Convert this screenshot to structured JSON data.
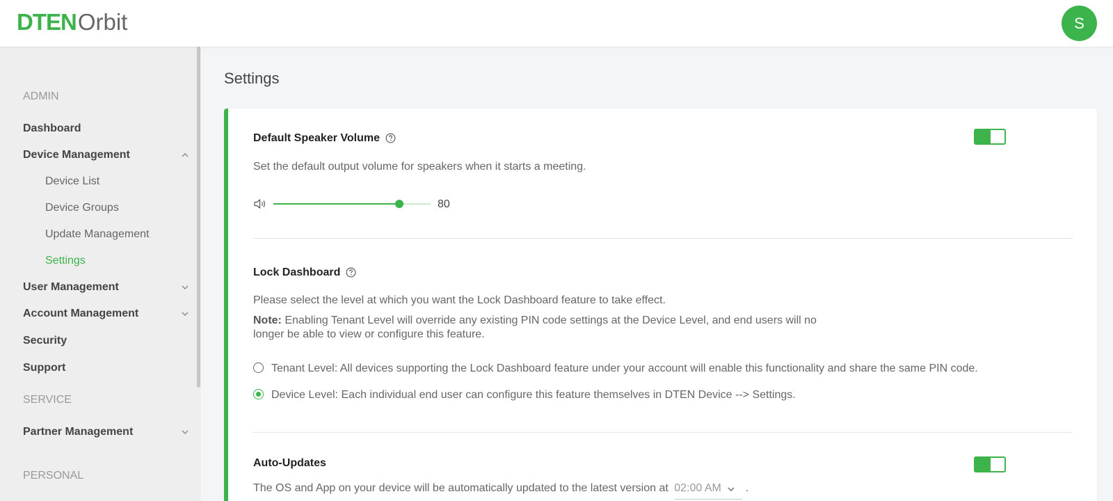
{
  "header": {
    "logo_brand": "DTEN",
    "logo_product": "Orbit",
    "avatar_initial": "S"
  },
  "sidebar": {
    "admin_label": "ADMIN",
    "service_label": "SERVICE",
    "personal_label": "PERSONAL",
    "items": [
      {
        "label": "Dashboard"
      },
      {
        "label": "Device Management"
      },
      {
        "label": "User Management"
      },
      {
        "label": "Account Management"
      },
      {
        "label": "Security"
      },
      {
        "label": "Support"
      },
      {
        "label": "Partner Management"
      }
    ],
    "sub_items": [
      {
        "label": "Device List"
      },
      {
        "label": "Device Groups"
      },
      {
        "label": "Update Management"
      },
      {
        "label": "Settings"
      }
    ]
  },
  "main": {
    "title": "Settings",
    "speaker": {
      "title": "Default Speaker Volume",
      "description": "Set the default output volume for speakers when it starts a meeting.",
      "volume": 80,
      "enabled": true
    },
    "lock": {
      "title": "Lock Dashboard",
      "description": "Please select the level at which you want the Lock Dashboard feature to take effect.",
      "note_label": "Note:",
      "note_line1": "Enabling Tenant Level will override any existing PIN code settings at the Device Level, and end users will no",
      "note_line2": "longer be able to view or configure this feature.",
      "options": [
        {
          "label": "Tenant Level: All devices supporting the Lock Dashboard feature under your account will enable this functionality and share the same PIN code.",
          "selected": false
        },
        {
          "label": "Device Level: Each individual end user can configure this feature themselves in DTEN Device --> Settings.",
          "selected": true
        }
      ]
    },
    "auto_updates": {
      "title": "Auto-Updates",
      "description": "The OS and App on your device will be automatically updated to the latest version at",
      "time": "02:00 AM",
      "suffix": ".",
      "enabled": true
    }
  },
  "colors": {
    "accent": "#3cb44b",
    "sidebar_bg": "#eeeeee",
    "page_bg": "#f4f5f7"
  }
}
